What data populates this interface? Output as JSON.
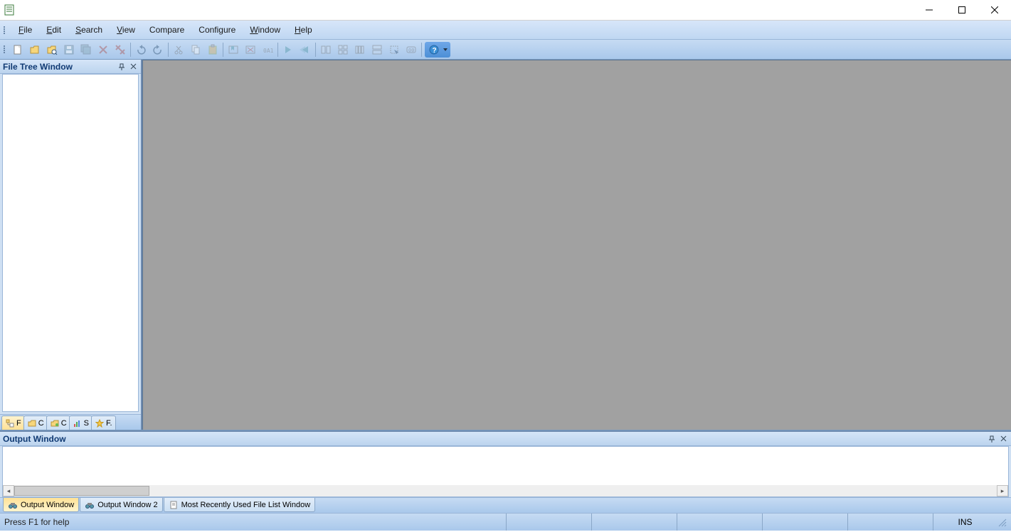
{
  "menus": {
    "file": "File",
    "edit": "Edit",
    "search": "Search",
    "view": "View",
    "compare": "Compare",
    "configure": "Configure",
    "window": "Window",
    "help": "Help"
  },
  "toolbar_icons": {
    "new_file": "new-file",
    "open_file": "open-file",
    "open_folder": "open-folder",
    "save": "save",
    "save_all": "save-all",
    "close": "close",
    "close_all": "close-all",
    "undo": "undo",
    "redo": "redo",
    "cut": "cut",
    "copy": "copy",
    "paste": "paste",
    "toggle_bookmark": "toggle-bookmark",
    "next_bookmark": "next-bookmark",
    "binary_mode": "binary-mode",
    "nav_fwd": "nav-forward",
    "nav_back": "nav-back",
    "compare_1": "compare-split",
    "compare_2": "compare-three",
    "compare_3": "compare-grid",
    "compare_4": "compare-rows",
    "tool_a": "tool-a",
    "tool_b": "tool-b",
    "help": "help"
  },
  "side_panel": {
    "title": "File Tree Window",
    "tabs": [
      {
        "label": "F",
        "icon": "tree-file-icon",
        "active": true
      },
      {
        "label": "C",
        "icon": "folder-icon",
        "active": false
      },
      {
        "label": "C",
        "icon": "folder2-icon",
        "active": false
      },
      {
        "label": "S",
        "icon": "bar-chart-icon",
        "active": false
      },
      {
        "label": "F.",
        "icon": "star-icon",
        "active": false
      }
    ]
  },
  "output_panel": {
    "title": "Output Window",
    "tabs": [
      {
        "label": "Output Window",
        "icon": "binoculars-icon",
        "active": true
      },
      {
        "label": "Output Window 2",
        "icon": "binoculars-icon",
        "active": false
      },
      {
        "label": "Most Recently Used File List Window",
        "icon": "document-icon",
        "active": false
      }
    ]
  },
  "statusbar": {
    "message": "Press F1 for help",
    "mode": "INS"
  }
}
